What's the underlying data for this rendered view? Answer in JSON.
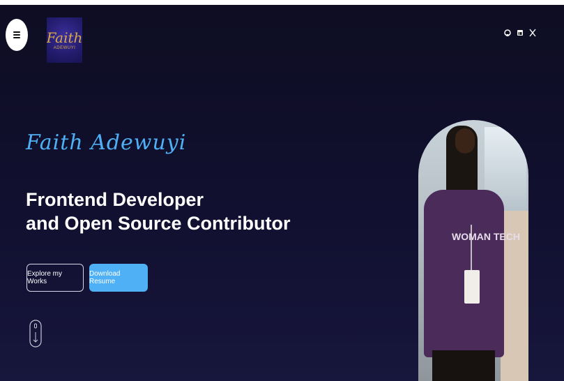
{
  "header": {
    "logo": {
      "script_text": "Faith",
      "sub_text": "ADEWUYI"
    },
    "social_icons": [
      "github-icon",
      "linkedin-icon",
      "x-icon"
    ]
  },
  "hero": {
    "name": "Faith Adewuyi",
    "title_line1": "Frontend Developer",
    "title_line2": "and Open Source Contributor",
    "explore_label": "Explore my Works",
    "download_label": "Download Resume"
  },
  "photo": {
    "shirt_text": "WOMAN TECH"
  },
  "colors": {
    "background": "#0f0e24",
    "accent": "#4fb0f5",
    "text": "#ffffff"
  }
}
